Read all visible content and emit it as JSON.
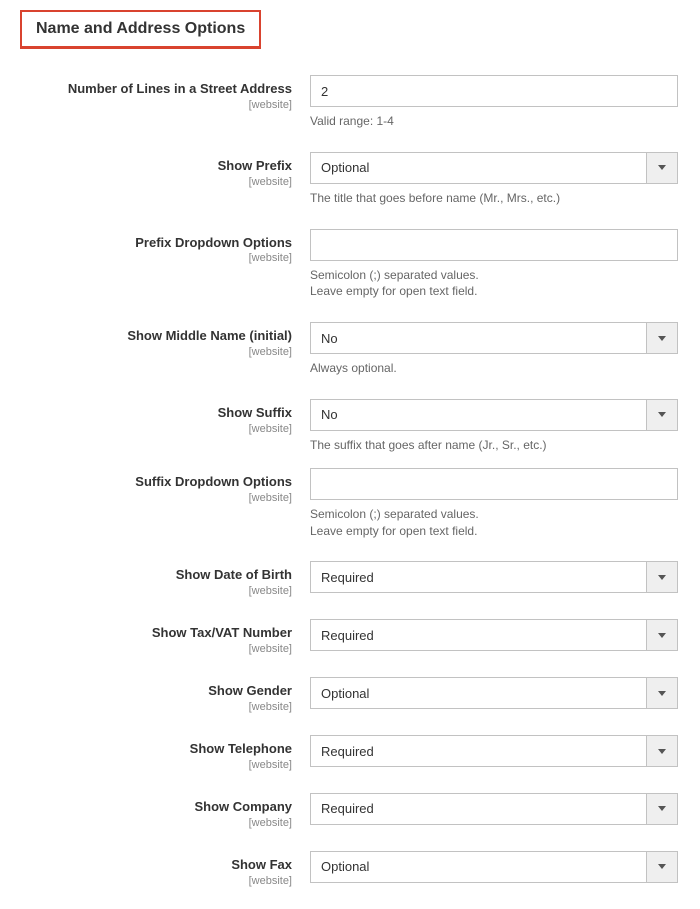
{
  "section": {
    "title": "Name and Address Options"
  },
  "scope_label": "[website]",
  "fields": {
    "street_lines": {
      "label": "Number of Lines in a Street Address",
      "value": "2",
      "help": "Valid range: 1-4"
    },
    "show_prefix": {
      "label": "Show Prefix",
      "value": "Optional",
      "help": "The title that goes before name (Mr., Mrs., etc.)"
    },
    "prefix_options": {
      "label": "Prefix Dropdown Options",
      "value": "",
      "help_line1": "Semicolon (;) separated values.",
      "help_line2": "Leave empty for open text field."
    },
    "show_middle": {
      "label": "Show Middle Name (initial)",
      "value": "No",
      "help": "Always optional."
    },
    "show_suffix": {
      "label": "Show Suffix",
      "value": "No",
      "help": "The suffix that goes after name (Jr., Sr., etc.)"
    },
    "suffix_options": {
      "label": "Suffix Dropdown Options",
      "value": "",
      "help_line1": "Semicolon (;) separated values.",
      "help_line2": "Leave empty for open text field."
    },
    "show_dob": {
      "label": "Show Date of Birth",
      "value": "Required"
    },
    "show_taxvat": {
      "label": "Show Tax/VAT Number",
      "value": "Required"
    },
    "show_gender": {
      "label": "Show Gender",
      "value": "Optional"
    },
    "show_telephone": {
      "label": "Show Telephone",
      "value": "Required"
    },
    "show_company": {
      "label": "Show Company",
      "value": "Required"
    },
    "show_fax": {
      "label": "Show Fax",
      "value": "Optional"
    }
  }
}
